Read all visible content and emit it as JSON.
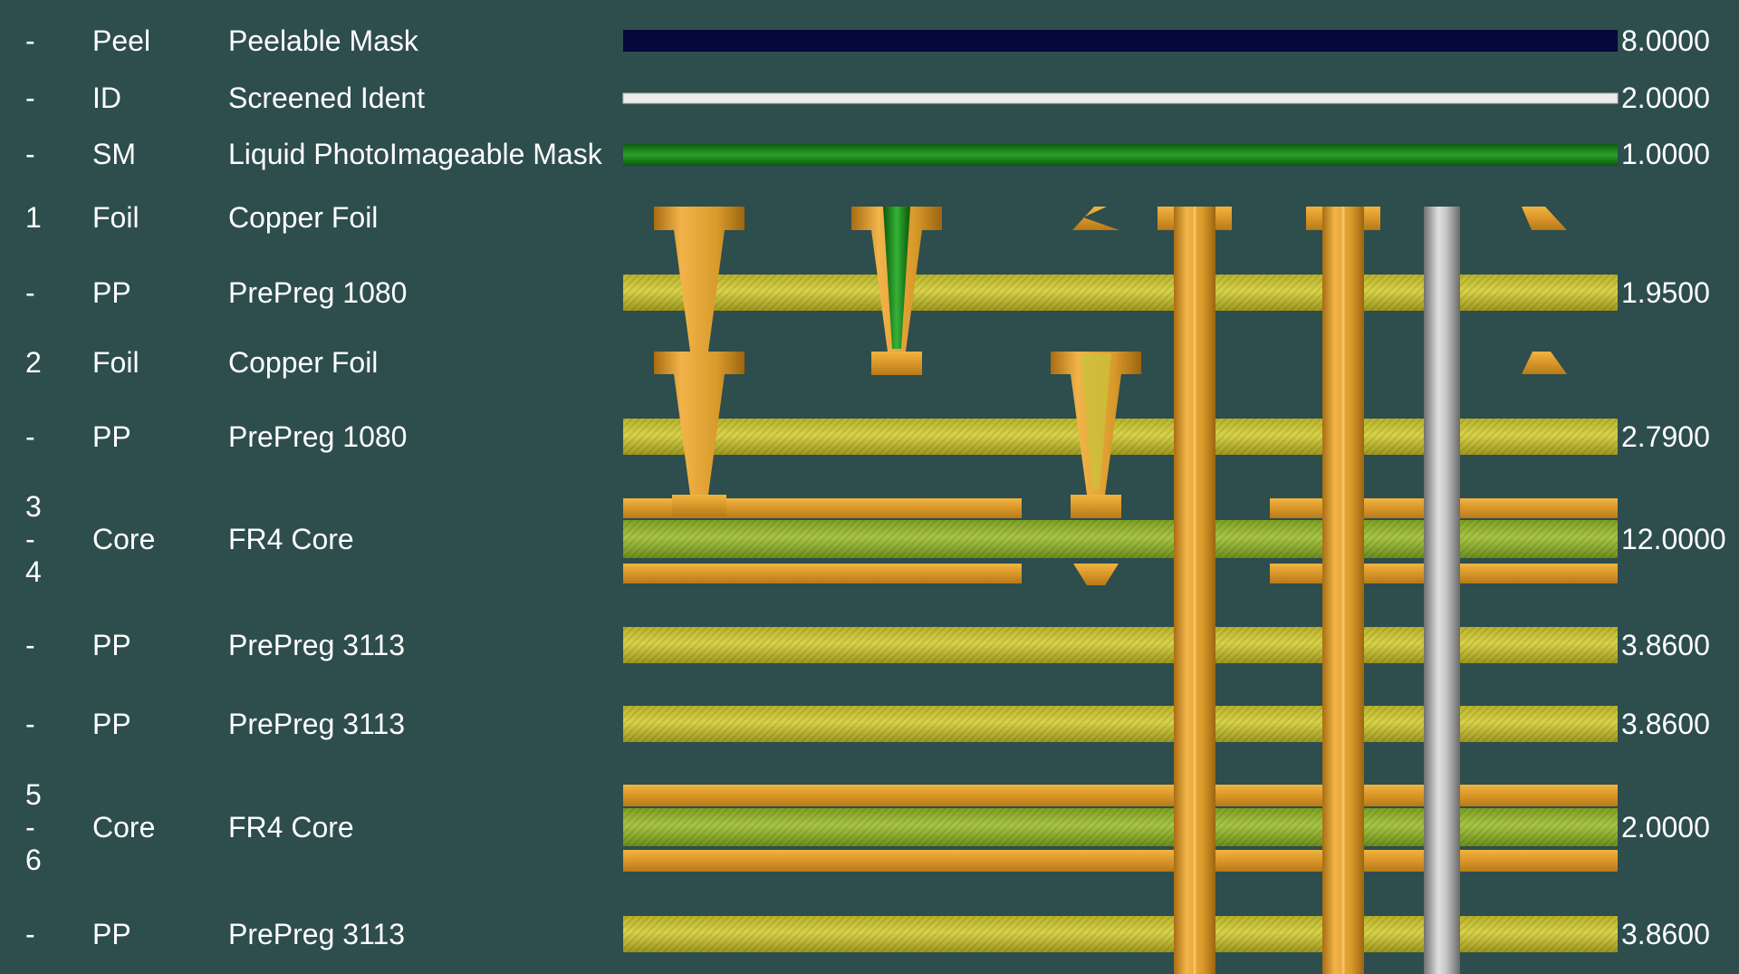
{
  "rows": [
    {
      "layer": "-",
      "type": "Peel",
      "name": "Peelable Mask",
      "thickness": "8.0000"
    },
    {
      "layer": "-",
      "type": "ID",
      "name": "Screened Ident",
      "thickness": "2.0000"
    },
    {
      "layer": "-",
      "type": "SM",
      "name": "Liquid PhotoImageable Mask",
      "thickness": "1.0000"
    },
    {
      "layer": "1",
      "type": "Foil",
      "name": "Copper Foil",
      "thickness": ""
    },
    {
      "layer": "-",
      "type": "PP",
      "name": "PrePreg 1080",
      "thickness": "1.9500"
    },
    {
      "layer": "2",
      "type": "Foil",
      "name": "Copper Foil",
      "thickness": ""
    },
    {
      "layer": "-",
      "type": "PP",
      "name": "PrePreg 1080",
      "thickness": "2.7900"
    },
    {
      "layer_lines": [
        "3",
        "-",
        "4"
      ],
      "type": "Core",
      "name": "FR4 Core",
      "thickness": "12.0000"
    },
    {
      "layer": "-",
      "type": "PP",
      "name": "PrePreg 3113",
      "thickness": "3.8600"
    },
    {
      "layer": "-",
      "type": "PP",
      "name": "PrePreg 3113",
      "thickness": "3.8600"
    },
    {
      "layer_lines": [
        "5",
        "-",
        "6"
      ],
      "type": "Core",
      "name": "FR4 Core",
      "thickness": "2.0000"
    },
    {
      "layer": "-",
      "type": "PP",
      "name": "PrePreg 3113",
      "thickness": "3.8600"
    }
  ],
  "colors": {
    "background": "#2e4d4d",
    "peelable_mask": "#05083a",
    "screened_ident": "#e8e8e8",
    "solder_mask": "#1f8a1f",
    "prepreg": "#c9c43a",
    "core": "#9dbb3a",
    "copper": "#d99a2b",
    "via_plating": "#c88a22",
    "drill_hole": "#a9a9a9"
  }
}
